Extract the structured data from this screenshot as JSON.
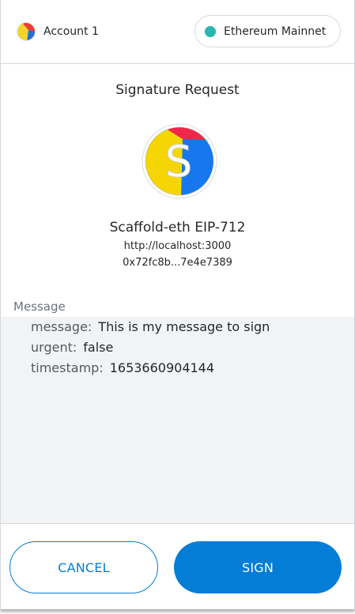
{
  "header": {
    "account_name": "Account 1",
    "network_name": "Ethereum Mainnet",
    "network_color": "#29b6af"
  },
  "request": {
    "title": "Signature Request",
    "site_logo_letter": "S",
    "site_name": "Scaffold-eth EIP-712",
    "site_origin": "http://localhost:3000",
    "contract_address": "0x72fc8b...7e4e7389"
  },
  "message": {
    "label": "Message",
    "fields": [
      {
        "key": "message:",
        "value": "This is my message to sign"
      },
      {
        "key": "urgent:",
        "value": "false"
      },
      {
        "key": "timestamp:",
        "value": "1653660904144"
      }
    ]
  },
  "footer": {
    "cancel_label": "CANCEL",
    "sign_label": "SIGN",
    "accent_color": "#037dd6"
  }
}
